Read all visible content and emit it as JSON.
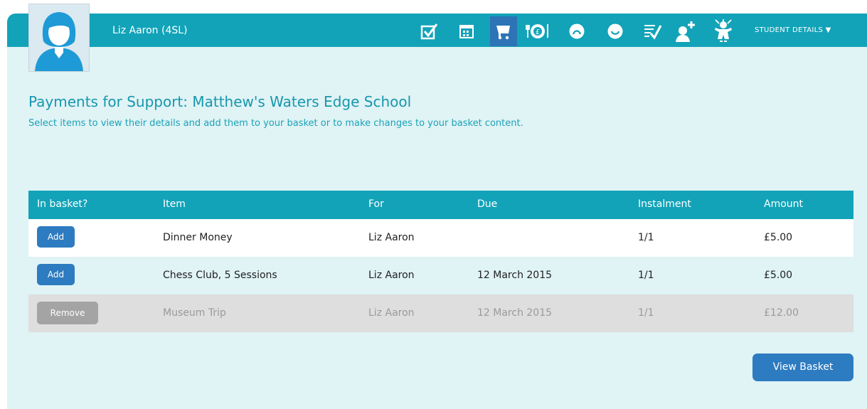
{
  "header": {
    "student_name": "Liz Aaron (4SL)",
    "student_details_label": "STUDENT DETAILS ▼",
    "nav_icons": [
      "checkbox-icon",
      "calendar-icon",
      "shopping-cart-icon",
      "dinner-money-icon",
      "frown-icon",
      "smile-icon",
      "report-icon",
      "add-contact-icon",
      "child-icon"
    ],
    "active_icon": "shopping-cart-icon"
  },
  "page": {
    "title": "Payments for Support: Matthew's Waters Edge School",
    "subtitle": "Select items to view their details and add them to your basket or to make changes to your basket content."
  },
  "table": {
    "headers": [
      "In basket?",
      "Item",
      "For",
      "Due",
      "Instalment",
      "Amount"
    ],
    "rows": [
      {
        "action": "Add",
        "item": "Dinner Money",
        "for": "Liz Aaron",
        "due": "",
        "instalment": "1/1",
        "amount": "£5.00"
      },
      {
        "action": "Add",
        "item": "Chess Club, 5 Sessions",
        "for": "Liz Aaron",
        "due": "12 March 2015",
        "instalment": "1/1",
        "amount": "£5.00"
      },
      {
        "action": "Remove",
        "item": "Museum Trip",
        "for": "Liz Aaron",
        "due": "12 March 2015",
        "instalment": "1/1",
        "amount": "£12.00"
      }
    ]
  },
  "view_basket_label": "View Basket",
  "colors": {
    "teal": "#12a3b8",
    "panel": "#e0f3f5",
    "button_blue": "#2d7bc0",
    "remove_gray": "#a4a4a4",
    "title": "#1697ad"
  }
}
